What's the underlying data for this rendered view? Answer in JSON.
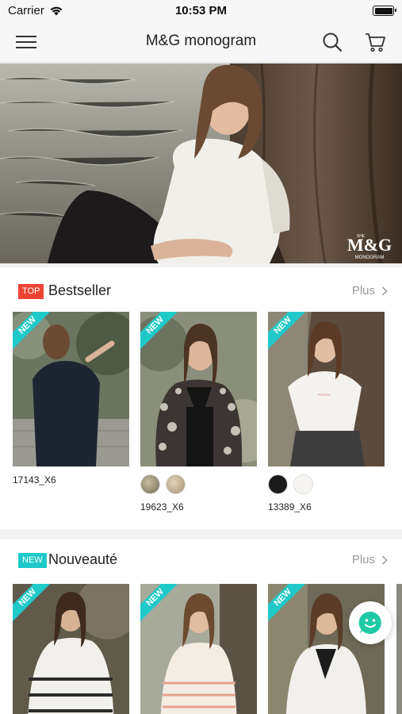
{
  "status": {
    "carrier": "Carrier",
    "time": "10:53 PM"
  },
  "nav": {
    "title": "M&G monogram",
    "menu_icon": "hamburger-menu-icon",
    "search_icon": "search-icon",
    "cart_icon": "cart-icon"
  },
  "hero": {
    "logo_main": "M&G",
    "logo_small_top": "SHE",
    "logo_sub": "MONOGRAM"
  },
  "colors": {
    "accent_teal": "#20c9c9",
    "top_red": "#ee4433"
  },
  "bestseller": {
    "badge": "TOP",
    "title": "Bestseller",
    "more": "Plus",
    "products": [
      {
        "sku": "17143_X6",
        "badge": "NEW"
      },
      {
        "sku": "19623_X6",
        "badge": "NEW",
        "swatches": [
          "leopard-tan",
          "leopard-beige"
        ]
      },
      {
        "sku": "13389_X6",
        "badge": "NEW",
        "swatches": [
          "black",
          "white-print"
        ]
      }
    ]
  },
  "nouveaute": {
    "badge": "NEW",
    "title": "Nouveauté",
    "more": "Plus",
    "products": [
      {
        "badge": "NEW"
      },
      {
        "badge": "NEW"
      },
      {
        "badge": "NEW"
      }
    ]
  },
  "chat": {
    "icon": "chat-smile-icon"
  }
}
